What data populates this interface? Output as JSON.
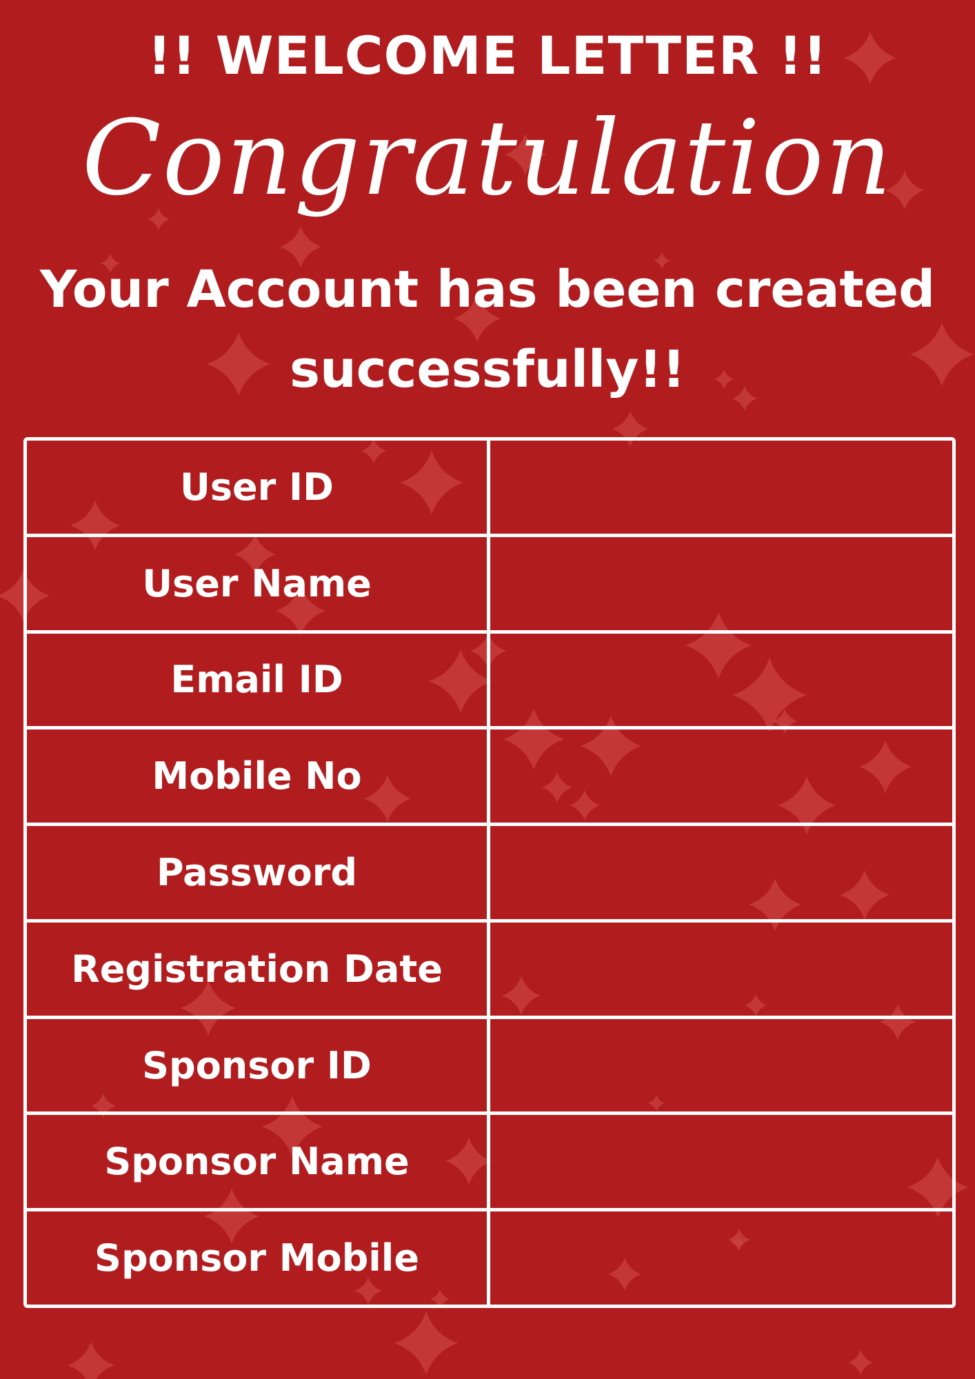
{
  "header": {
    "welcome_title": "!! WELCOME LETTER !!",
    "script_title": "Congratulation",
    "subtitle": "Your Account has been created successfully!!"
  },
  "table": {
    "rows": [
      {
        "label": "User ID",
        "value": ""
      },
      {
        "label": "User Name",
        "value": ""
      },
      {
        "label": "Email ID",
        "value": ""
      },
      {
        "label": "Mobile No",
        "value": ""
      },
      {
        "label": "Password",
        "value": ""
      },
      {
        "label": "Registration Date",
        "value": ""
      },
      {
        "label": "Sponsor ID",
        "value": ""
      },
      {
        "label": "Sponsor Name",
        "value": ""
      },
      {
        "label": "Sponsor Mobile",
        "value": ""
      }
    ]
  },
  "colors": {
    "background": "#b11d1f",
    "text": "#ffffff",
    "sparkle": "#c94240"
  },
  "decorations": {
    "icon": "sparkle-icon"
  }
}
